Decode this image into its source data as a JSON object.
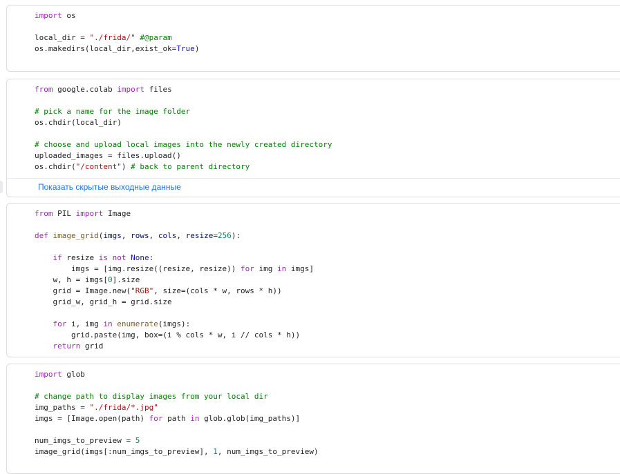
{
  "cells": [
    {
      "lines": [
        [
          [
            "import",
            "kw"
          ],
          [
            " os",
            ""
          ]
        ],
        [],
        [
          [
            "local_dir",
            ""
          ],
          [
            " = ",
            ""
          ],
          [
            "\"./frida/\"",
            "str"
          ],
          [
            " ",
            ""
          ],
          [
            "#@param",
            "cm"
          ]
        ],
        [
          [
            "os.makedirs(local_dir,",
            ""
          ],
          [
            "exist_ok",
            ""
          ],
          [
            "=",
            ""
          ],
          [
            "True",
            "bi"
          ],
          [
            ")",
            ""
          ]
        ]
      ]
    },
    {
      "lines": [
        [
          [
            "from",
            "kw"
          ],
          [
            " google.colab ",
            ""
          ],
          [
            "import",
            "kw"
          ],
          [
            " files",
            ""
          ]
        ],
        [],
        [
          [
            "# pick a name for the image folder",
            "cm"
          ]
        ],
        [
          [
            "os.chdir(local_dir)",
            ""
          ]
        ],
        [],
        [
          [
            "# choose and upload local images into the newly created directory",
            "cm"
          ]
        ],
        [
          [
            "uploaded_images = files.upload()",
            ""
          ]
        ],
        [
          [
            "os.chdir(",
            ""
          ],
          [
            "\"/content\"",
            "str"
          ],
          [
            ") ",
            ""
          ],
          [
            "# back to parent directory",
            "cm"
          ]
        ]
      ],
      "output_link": "Показать скрытые выходные данные"
    },
    {
      "lines": [
        [
          [
            "from",
            "kw"
          ],
          [
            " PIL ",
            ""
          ],
          [
            "import",
            "kw"
          ],
          [
            " Image",
            ""
          ]
        ],
        [],
        [
          [
            "def",
            "kw"
          ],
          [
            " ",
            ""
          ],
          [
            "image_grid",
            "fn"
          ],
          [
            "(",
            ""
          ],
          [
            "imgs",
            "pr"
          ],
          [
            ", ",
            ""
          ],
          [
            "rows",
            "pr"
          ],
          [
            ", ",
            ""
          ],
          [
            "cols",
            "pr"
          ],
          [
            ", ",
            ""
          ],
          [
            "resize",
            "pr"
          ],
          [
            "=",
            ""
          ],
          [
            "256",
            "num"
          ],
          [
            "):",
            ""
          ]
        ],
        [],
        [
          [
            "    ",
            ""
          ],
          [
            "if",
            "kw"
          ],
          [
            " resize ",
            ""
          ],
          [
            "is",
            "kw"
          ],
          [
            " ",
            ""
          ],
          [
            "not",
            "kw"
          ],
          [
            " ",
            ""
          ],
          [
            "None",
            "bi"
          ],
          [
            ":",
            ""
          ]
        ],
        [
          [
            "        imgs = [img.resize((resize, resize)) ",
            ""
          ],
          [
            "for",
            "kw"
          ],
          [
            " img ",
            ""
          ],
          [
            "in",
            "kw"
          ],
          [
            " imgs]",
            ""
          ]
        ],
        [
          [
            "    w, h = imgs[",
            ""
          ],
          [
            "0",
            "num"
          ],
          [
            "].size",
            ""
          ]
        ],
        [
          [
            "    grid = Image.new(",
            ""
          ],
          [
            "\"RGB\"",
            "str"
          ],
          [
            ", size=(cols * w, rows * h))",
            ""
          ]
        ],
        [
          [
            "    grid_w, grid_h = grid.size",
            ""
          ]
        ],
        [],
        [
          [
            "    ",
            ""
          ],
          [
            "for",
            "kw"
          ],
          [
            " i, img ",
            ""
          ],
          [
            "in",
            "kw"
          ],
          [
            " ",
            ""
          ],
          [
            "enumerate",
            "fn"
          ],
          [
            "(imgs):",
            ""
          ]
        ],
        [
          [
            "        grid.paste(img, box=(i % cols * w, i // cols * h))",
            ""
          ]
        ],
        [
          [
            "    ",
            ""
          ],
          [
            "return",
            "kw"
          ],
          [
            " grid",
            ""
          ]
        ]
      ]
    },
    {
      "lines": [
        [
          [
            "import",
            "kw"
          ],
          [
            " glob",
            ""
          ]
        ],
        [],
        [
          [
            "# change path to display images from your local dir",
            "cm"
          ]
        ],
        [
          [
            "img_paths = ",
            ""
          ],
          [
            "\"./frida/*.jpg\"",
            "str"
          ]
        ],
        [
          [
            "imgs = [Image.open(path) ",
            ""
          ],
          [
            "for",
            "kw"
          ],
          [
            " path ",
            ""
          ],
          [
            "in",
            "kw"
          ],
          [
            " glob.glob(img_paths)]",
            ""
          ]
        ],
        [],
        [
          [
            "num_imgs_to_preview = ",
            ""
          ],
          [
            "5",
            "num"
          ]
        ],
        [
          [
            "image_grid(imgs[:num_imgs_to_preview], ",
            ""
          ],
          [
            "1",
            "num"
          ],
          [
            ", num_imgs_to_preview)",
            ""
          ]
        ]
      ]
    }
  ]
}
